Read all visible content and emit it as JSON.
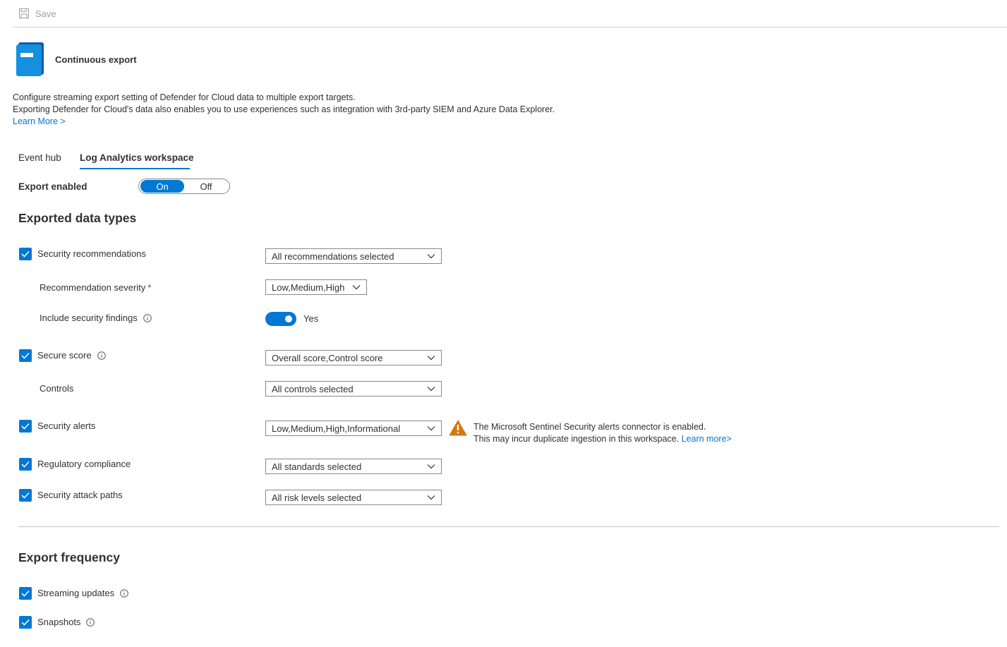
{
  "toolbar": {
    "save_label": "Save"
  },
  "header": {
    "title": "Continuous export"
  },
  "description": {
    "line1": "Configure streaming export setting of Defender for Cloud data to multiple export targets.",
    "line2": "Exporting Defender for Cloud's data also enables you to use experiences such as integration with 3rd-party SIEM and Azure Data Explorer.",
    "learn_more": "Learn More >"
  },
  "tabs": [
    {
      "label": "Event hub",
      "active": false
    },
    {
      "label": "Log Analytics workspace",
      "active": true
    }
  ],
  "export_enabled": {
    "label": "Export enabled",
    "on": "On",
    "off": "Off",
    "selected": "On"
  },
  "data_types": {
    "heading": "Exported data types",
    "security_recommendations": {
      "label": "Security recommendations",
      "checked": true,
      "value": "All recommendations selected"
    },
    "recommendation_severity": {
      "label": "Recommendation severity",
      "required": "*",
      "value": "Low,Medium,High"
    },
    "include_findings": {
      "label": "Include security findings",
      "toggle_label": "Yes",
      "on": true
    },
    "secure_score": {
      "label": "Secure score",
      "checked": true,
      "value": "Overall score,Control score"
    },
    "controls": {
      "label": "Controls",
      "value": "All controls selected"
    },
    "security_alerts": {
      "label": "Security alerts",
      "checked": true,
      "value": "Low,Medium,High,Informational"
    },
    "regulatory_compliance": {
      "label": "Regulatory compliance",
      "checked": true,
      "value": "All standards selected"
    },
    "attack_paths": {
      "label": "Security attack paths",
      "checked": true,
      "value": "All risk levels selected"
    }
  },
  "warning": {
    "line1": "The Microsoft Sentinel Security alerts connector is enabled.",
    "line2": "This may incur duplicate ingestion in this workspace.",
    "learn_more": "Learn more>"
  },
  "frequency": {
    "heading": "Export frequency",
    "streaming": {
      "label": "Streaming updates",
      "checked": true
    },
    "snapshots": {
      "label": "Snapshots",
      "checked": true
    }
  },
  "colors": {
    "accent": "#0078d4",
    "warning": "#d97706",
    "text": "#323130",
    "border": "#8a8886"
  }
}
